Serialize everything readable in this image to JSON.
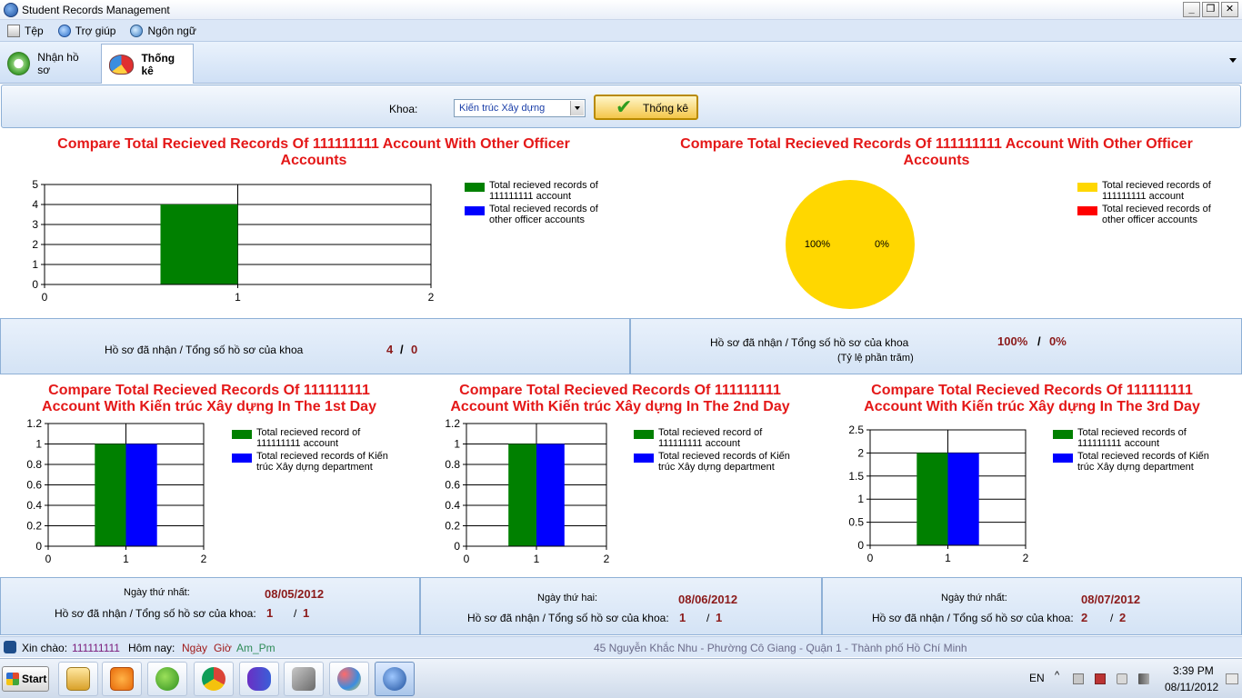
{
  "window": {
    "title": "Student Records Management",
    "buttons": [
      "_",
      "❐",
      "✕"
    ]
  },
  "menu": {
    "items": [
      {
        "label": "Tệp",
        "icon": "file-icon"
      },
      {
        "label": "Trợ giúp",
        "icon": "help-icon"
      },
      {
        "label": "Ngôn ngữ",
        "icon": "globe-icon"
      }
    ]
  },
  "tabs": [
    {
      "label": "Nhận hồ sơ",
      "icon": "back-arrow-icon",
      "active": false
    },
    {
      "label": "Thống kê",
      "icon": "pie-chart-icon",
      "active": true
    }
  ],
  "filter": {
    "label": "Khoa:",
    "selected": "Kiến trúc Xây dựng",
    "button_label": "Thống kê"
  },
  "colors": {
    "green": "#008000",
    "blue": "#0000ff",
    "yellow": "#ffd700",
    "red": "#ff0000",
    "title_red": "#e41818",
    "value_red": "#8b1a1a"
  },
  "chart_data": [
    {
      "id": "top-bar",
      "type": "bar",
      "title": "Compare Total Recieved Records Of 111111111 Account With Other Officer Accounts",
      "x_ticks": [
        "0",
        "1",
        "2"
      ],
      "y_ticks": [
        "0",
        "1",
        "2",
        "3",
        "4",
        "5"
      ],
      "ylim": [
        0,
        5
      ],
      "xlim": [
        0,
        2
      ],
      "series": [
        {
          "name": "Total recieved records of 111111111 account",
          "color": "#008000",
          "values": [
            4
          ]
        },
        {
          "name": "Total recieved records of other officer accounts",
          "color": "#0000ff",
          "values": [
            0
          ]
        }
      ],
      "x": [
        1
      ],
      "legend": "right"
    },
    {
      "id": "top-pie",
      "type": "pie",
      "title": "Compare Total Recieved Records Of 111111111 Account With Other Officer Accounts",
      "slices": [
        {
          "name": "Total recieved records of 111111111 account",
          "color": "#ffd700",
          "value": 100,
          "label": "100%"
        },
        {
          "name": "Total recieved records of other officer accounts",
          "color": "#ff0000",
          "value": 0,
          "label": "0%"
        }
      ],
      "legend": "right"
    },
    {
      "id": "day1",
      "type": "bar",
      "title": "Compare Total Recieved Records Of 111111111 Account With Kiến trúc Xây dựng In The 1st Day",
      "x_ticks": [
        "0",
        "1",
        "2"
      ],
      "y_ticks": [
        "0",
        "0.2",
        "0.4",
        "0.6",
        "0.8",
        "1",
        "1.2"
      ],
      "ylim": [
        0,
        1.2
      ],
      "xlim": [
        0,
        2
      ],
      "series": [
        {
          "name": "Total recieved record of 111111111 account",
          "color": "#008000",
          "values": [
            1
          ]
        },
        {
          "name": "Total recieved records of Kiến trúc Xây dựng department",
          "color": "#0000ff",
          "values": [
            1
          ]
        }
      ],
      "x": [
        1
      ],
      "legend": "right"
    },
    {
      "id": "day2",
      "type": "bar",
      "title": "Compare Total Recieved Records Of 111111111 Account With Kiến trúc Xây dựng In The 2nd Day",
      "x_ticks": [
        "0",
        "1",
        "2"
      ],
      "y_ticks": [
        "0",
        "0.2",
        "0.4",
        "0.6",
        "0.8",
        "1",
        "1.2"
      ],
      "ylim": [
        0,
        1.2
      ],
      "xlim": [
        0,
        2
      ],
      "series": [
        {
          "name": "Total recieved record of 111111111 account",
          "color": "#008000",
          "values": [
            1
          ]
        },
        {
          "name": "Total recieved records of Kiến trúc Xây dựng department",
          "color": "#0000ff",
          "values": [
            1
          ]
        }
      ],
      "x": [
        1
      ],
      "legend": "right"
    },
    {
      "id": "day3",
      "type": "bar",
      "title": "Compare Total Recieved Records Of 111111111 Account With Kiến trúc Xây dựng In The 3rd Day",
      "x_ticks": [
        "0",
        "1",
        "2"
      ],
      "y_ticks": [
        "0",
        "0.5",
        "1",
        "1.5",
        "2",
        "2.5"
      ],
      "ylim": [
        0,
        2.5
      ],
      "xlim": [
        0,
        2
      ],
      "series": [
        {
          "name": "Total recieved records of 111111111 account",
          "color": "#008000",
          "values": [
            2
          ]
        },
        {
          "name": "Total recieved records of Kiến trúc Xây dựng department",
          "color": "#0000ff",
          "values": [
            2
          ]
        }
      ],
      "x": [
        1
      ],
      "legend": "right"
    }
  ],
  "summary": {
    "left": {
      "label": "Hồ sơ đã nhận / Tổng số hồ sơ của khoa",
      "received": "4",
      "sep": "/",
      "total": "0"
    },
    "right": {
      "label": "Hồ sơ đã nhận / Tổng số hồ sơ của khoa",
      "sublabel": "(Tỷ lệ phần trăm)",
      "received": "100%",
      "sep": "/",
      "total": "0%"
    }
  },
  "days": [
    {
      "day_label": "Ngày thứ nhất:",
      "date": "08/05/2012",
      "label": "Hồ sơ đã nhận / Tổng số hồ sơ của khoa:",
      "received": "1",
      "sep": "/",
      "total": "1"
    },
    {
      "day_label": "Ngày thứ hai:",
      "date": "08/06/2012",
      "label": "Hồ sơ đã nhận / Tổng số hồ sơ của khoa:",
      "received": "1",
      "sep": "/",
      "total": "1"
    },
    {
      "day_label": "Ngày thứ nhất:",
      "date": "08/07/2012",
      "label": "Hồ sơ đã nhận / Tổng số hồ sơ của khoa:",
      "received": "2",
      "sep": "/",
      "total": "2"
    }
  ],
  "status": {
    "greeting": "Xin chào:",
    "user": "111111111",
    "today": "Hôm nay:",
    "day": "Ngày",
    "hour": "Giờ",
    "ampm": "Am_Pm",
    "address": "45 Nguyễn Khắc Nhu - Phường Cô Giang - Quận 1 - Thành phố Hồ Chí Minh"
  },
  "taskbar": {
    "start": "Start",
    "apps": [
      "explorer-icon",
      "media-player-icon",
      "parrot-icon",
      "chrome-icon",
      "visual-studio-icon",
      "tools-icon",
      "paint-icon",
      "student-records-icon"
    ],
    "lang": "EN",
    "time": "3:39 PM",
    "date": "08/11/2012"
  }
}
